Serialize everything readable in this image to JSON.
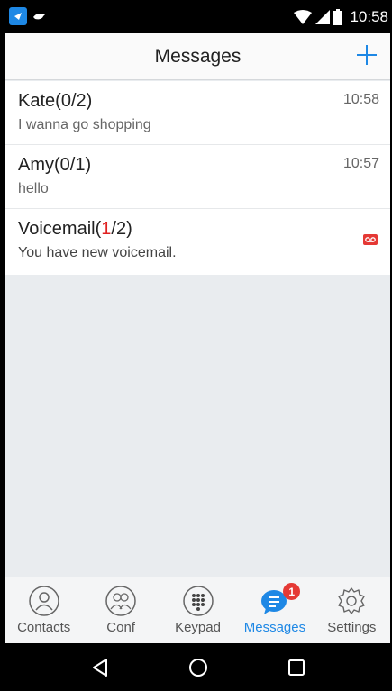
{
  "status_bar": {
    "time": "10:58",
    "accent": "#1e88e5"
  },
  "header": {
    "title": "Messages"
  },
  "messages": [
    {
      "name_prefix": "Kate(",
      "unread": "0",
      "name_suffix": "/2)",
      "preview": "I wanna go shopping",
      "time": "10:58",
      "unread_highlight": false
    },
    {
      "name_prefix": "Amy(",
      "unread": "0",
      "name_suffix": "/1)",
      "preview": "hello",
      "time": "10:57",
      "unread_highlight": false
    },
    {
      "name_prefix": "Voicemail(",
      "unread": "1",
      "name_suffix": "/2)",
      "preview": "You have new voicemail.",
      "icon": "voicemail-icon",
      "unread_highlight": true
    }
  ],
  "tabs": [
    {
      "label": "Contacts",
      "icon": "contacts-icon",
      "active": false
    },
    {
      "label": "Conf",
      "icon": "conference-icon",
      "active": false
    },
    {
      "label": "Keypad",
      "icon": "keypad-icon",
      "active": false
    },
    {
      "label": "Messages",
      "icon": "messages-icon",
      "active": true,
      "badge": "1"
    },
    {
      "label": "Settings",
      "icon": "gear-icon",
      "active": false
    }
  ],
  "colors": {
    "accent": "#1e88e5",
    "badge": "#e53935",
    "unread": "#e02020",
    "list_background": "#e9ecef"
  }
}
